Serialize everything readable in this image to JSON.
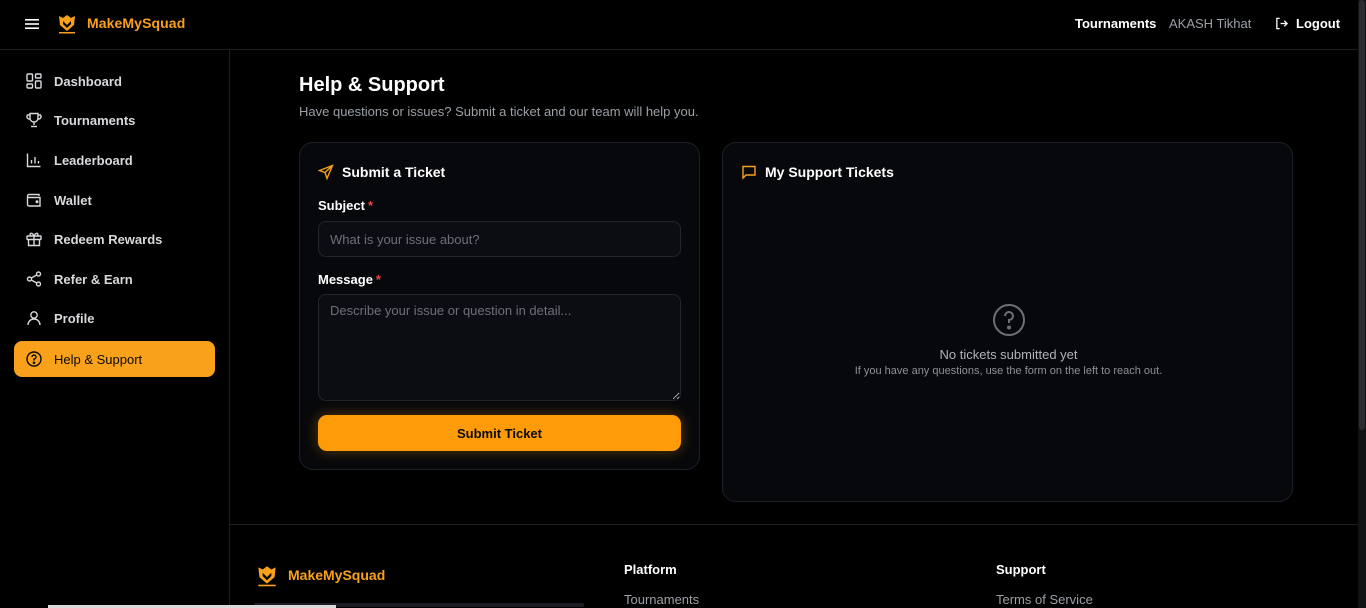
{
  "header": {
    "brand": "MakeMySquad",
    "nav_tournaments": "Tournaments",
    "user_name": "AKASH Tikhat",
    "logout": "Logout"
  },
  "sidebar": {
    "items": [
      {
        "label": "Dashboard",
        "icon": "grid-icon"
      },
      {
        "label": "Tournaments",
        "icon": "trophy-icon"
      },
      {
        "label": "Leaderboard",
        "icon": "bar-chart-icon"
      },
      {
        "label": "Wallet",
        "icon": "wallet-icon"
      },
      {
        "label": "Redeem Rewards",
        "icon": "gift-icon"
      },
      {
        "label": "Refer & Earn",
        "icon": "share-icon"
      },
      {
        "label": "Profile",
        "icon": "user-icon"
      },
      {
        "label": "Help & Support",
        "icon": "help-circle-icon",
        "active": true
      }
    ]
  },
  "main": {
    "title": "Help & Support",
    "subtitle": "Have questions or issues? Submit a ticket and our team will help you."
  },
  "ticket_form": {
    "title": "Submit a Ticket",
    "subject_label": "Subject",
    "subject_placeholder": "What is your issue about?",
    "subject_value": "",
    "message_label": "Message",
    "message_placeholder": "Describe your issue or question in detail...",
    "message_value": "",
    "required_mark": "*",
    "submit_label": "Submit Ticket"
  },
  "tickets": {
    "title": "My Support Tickets",
    "empty_title": "No tickets submitted yet",
    "empty_subtitle": "If you have any questions, use the form on the left to reach out."
  },
  "footer": {
    "brand": "MakeMySquad",
    "platform_title": "Platform",
    "platform_link": "Tournaments",
    "support_title": "Support",
    "support_link": "Terms of Service"
  },
  "colors": {
    "accent": "#f9a11b",
    "button": "#fd9b09",
    "background": "#000000",
    "card": "#07080b",
    "required": "#ef4444"
  }
}
